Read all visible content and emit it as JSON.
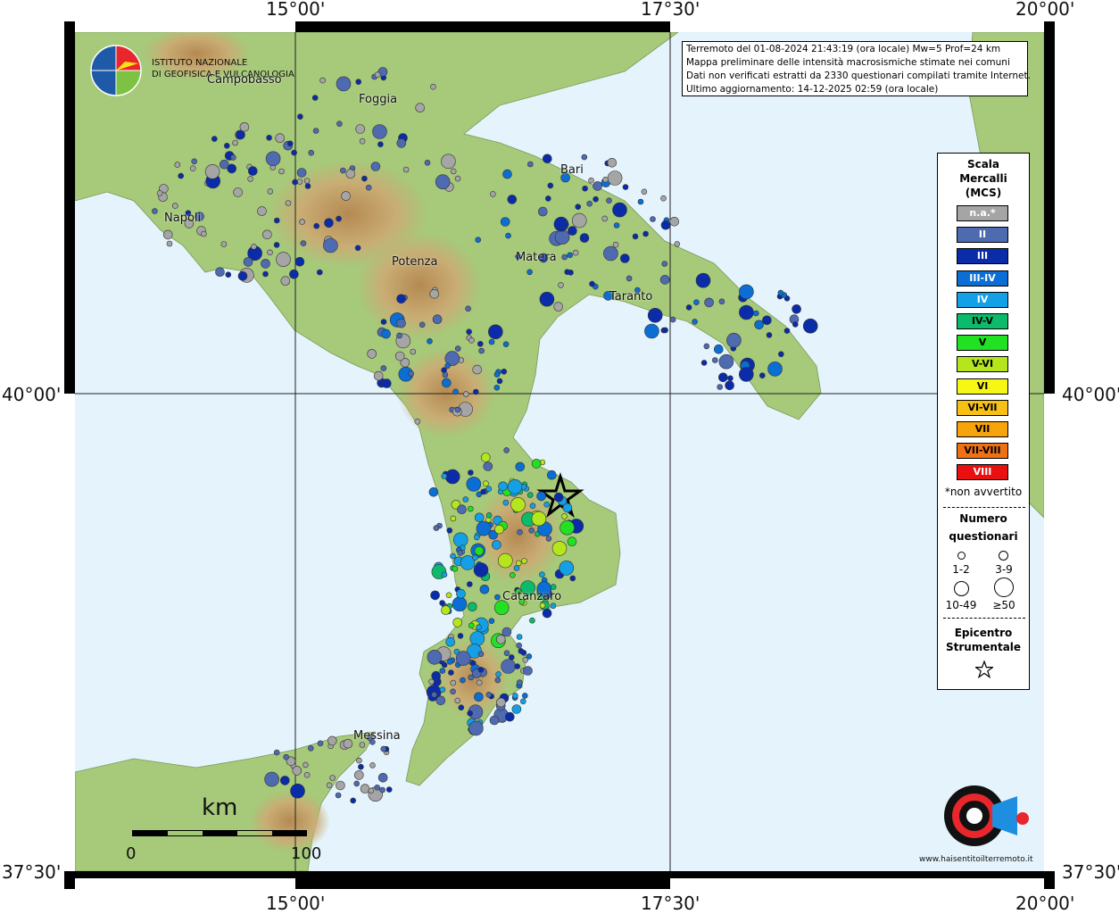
{
  "info_box": {
    "lines": [
      "Terremoto del 01-08-2024 21:43:19 (ora locale) Mw=5 Prof=24 km",
      "Mappa preliminare delle intensità macrosismiche stimate nei comuni",
      "Dati non verificati estratti da 2330 questionari compilati tramite Internet.",
      "Ultimo aggiornamento: 14-12-2025 02:59 (ora locale)"
    ]
  },
  "coordinates": {
    "top": [
      "15°00'",
      "17°30'",
      "20°00'"
    ],
    "bottom": [
      "15°00'",
      "17°30'",
      "20°00'"
    ],
    "left": [
      "40°00'",
      "37°30'"
    ],
    "right": [
      "40°00'",
      "37°30'"
    ]
  },
  "ingv": {
    "line1": "ISTITUTO NAZIONALE",
    "line2": "DI GEOFISICA E VULCANOLOGIA"
  },
  "cities": [
    "Campobasso",
    "Foggia",
    "Bari",
    "Napoli",
    "Potenza",
    "Matera",
    "Taranto",
    "Catanzaro",
    "Messina"
  ],
  "legend": {
    "title1": "Scala",
    "title2": "Mercalli",
    "title3": "(MCS)",
    "mcs": [
      {
        "label": "n.a.*",
        "color": "#a5a5a5",
        "text": "#ffffff"
      },
      {
        "label": "II",
        "color": "#4e6ab0",
        "text": "#ffffff"
      },
      {
        "label": "III",
        "color": "#0a2ca9",
        "text": "#ffffff"
      },
      {
        "label": "III-IV",
        "color": "#0a6ed4",
        "text": "#ffffff"
      },
      {
        "label": "IV",
        "color": "#14a0e6",
        "text": "#ffffff"
      },
      {
        "label": "IV-V",
        "color": "#0bbb6b",
        "text": "#000000"
      },
      {
        "label": "V",
        "color": "#22e022",
        "text": "#000000"
      },
      {
        "label": "V-VI",
        "color": "#b5e61d",
        "text": "#000000"
      },
      {
        "label": "VI",
        "color": "#f7f716",
        "text": "#000000"
      },
      {
        "label": "VI-VII",
        "color": "#f7c014",
        "text": "#000000"
      },
      {
        "label": "VII",
        "color": "#f7a30c",
        "text": "#000000"
      },
      {
        "label": "VII-VIII",
        "color": "#f07014",
        "text": "#000000"
      },
      {
        "label": "VIII",
        "color": "#e81010",
        "text": "#ffffff"
      }
    ],
    "note": "*non avvertito",
    "num_title1": "Numero",
    "num_title2": "questionari",
    "sizes": [
      "1-2",
      "3-9",
      "10-49",
      "≥50"
    ],
    "epi_title1": "Epicentro",
    "epi_title2": "Strumentale"
  },
  "scale_bar": {
    "unit": "km",
    "start": "0",
    "end": "100"
  },
  "logo_text": "www.haisentitoilterremoto.it"
}
